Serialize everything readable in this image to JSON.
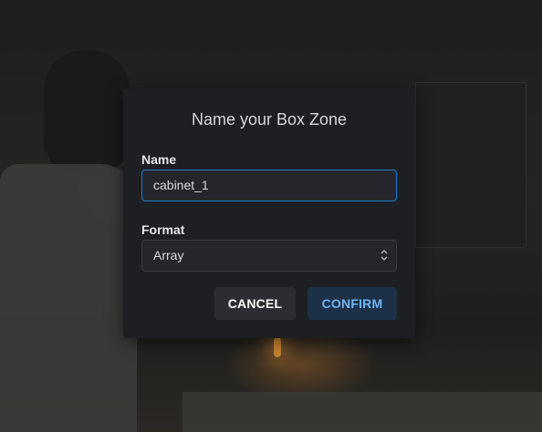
{
  "dialog": {
    "title": "Name your Box Zone",
    "name_label": "Name",
    "name_value": "cabinet_1",
    "format_label": "Format",
    "format_value": "Array",
    "cancel_label": "CANCEL",
    "confirm_label": "CONFIRM"
  },
  "colors": {
    "dialog_bg": "#1d1f23",
    "input_focus_border": "#1e7ad0",
    "confirm_text": "#6fb3f2",
    "confirm_bg": "#1c3147",
    "cancel_bg": "#2b2d32"
  },
  "icons": {
    "select_indicator": "select-chevrons-icon"
  }
}
